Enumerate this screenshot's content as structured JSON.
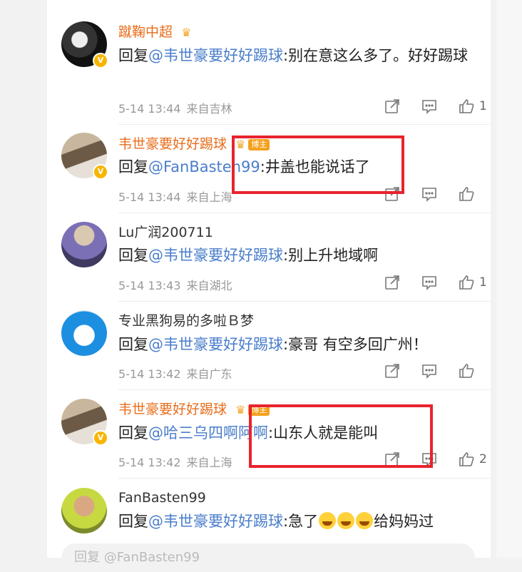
{
  "colors": {
    "accent_orange": "#e86d1b",
    "mention_blue": "#4a7ecb",
    "highlight_red": "#e8232d"
  },
  "comments": [
    {
      "username": "蹴鞠中超",
      "username_style": "orange",
      "badge": "crown-icon",
      "reply_prefix": "回复",
      "mention": "@韦世豪要好好踢球",
      "text": ":别在意这么多了。好好踢球",
      "date": "5-14 13:44",
      "location": "来自吉林",
      "likes": "1"
    },
    {
      "username": "韦世豪要好好踢球",
      "username_style": "orange",
      "badge": "crown-icon",
      "tag": "博主",
      "reply_prefix": "回复",
      "mention": "@FanBasten99",
      "text": ":井盖也能说话了",
      "date": "5-14 13:44",
      "location": "来自上海",
      "likes": ""
    },
    {
      "username": "Lu广润200711",
      "username_style": "gray",
      "reply_prefix": "回复",
      "mention": "@韦世豪要好好踢球",
      "text": ":别上升地域啊",
      "date": "5-14 13:43",
      "location": "来自湖北",
      "likes": "1"
    },
    {
      "username": "专业黑狗易的多啦Ｂ梦",
      "username_style": "gray",
      "reply_prefix": "回复",
      "mention": "@韦世豪要好好踢球",
      "text": ":豪哥 有空多回广州！",
      "date": "5-14 13:42",
      "location": "来自广东",
      "likes": ""
    },
    {
      "username": "韦世豪要好好踢球",
      "username_style": "orange",
      "badge": "crown-icon",
      "tag": "博主",
      "reply_prefix": "回复",
      "mention": "@哈三乌四啊阿啊",
      "text": ":山东人就是能叫",
      "date": "5-14 13:42",
      "location": "来自上海",
      "likes": "2"
    },
    {
      "username": "FanBasten99",
      "username_style": "gray",
      "reply_prefix": "回复",
      "mention": "@韦世豪要好好踢球",
      "text": ":急了",
      "text_after_emoji": "给妈妈过",
      "emoji": "crying-laugh-emoji"
    }
  ],
  "input": {
    "placeholder": "回复 @FanBasten99"
  }
}
